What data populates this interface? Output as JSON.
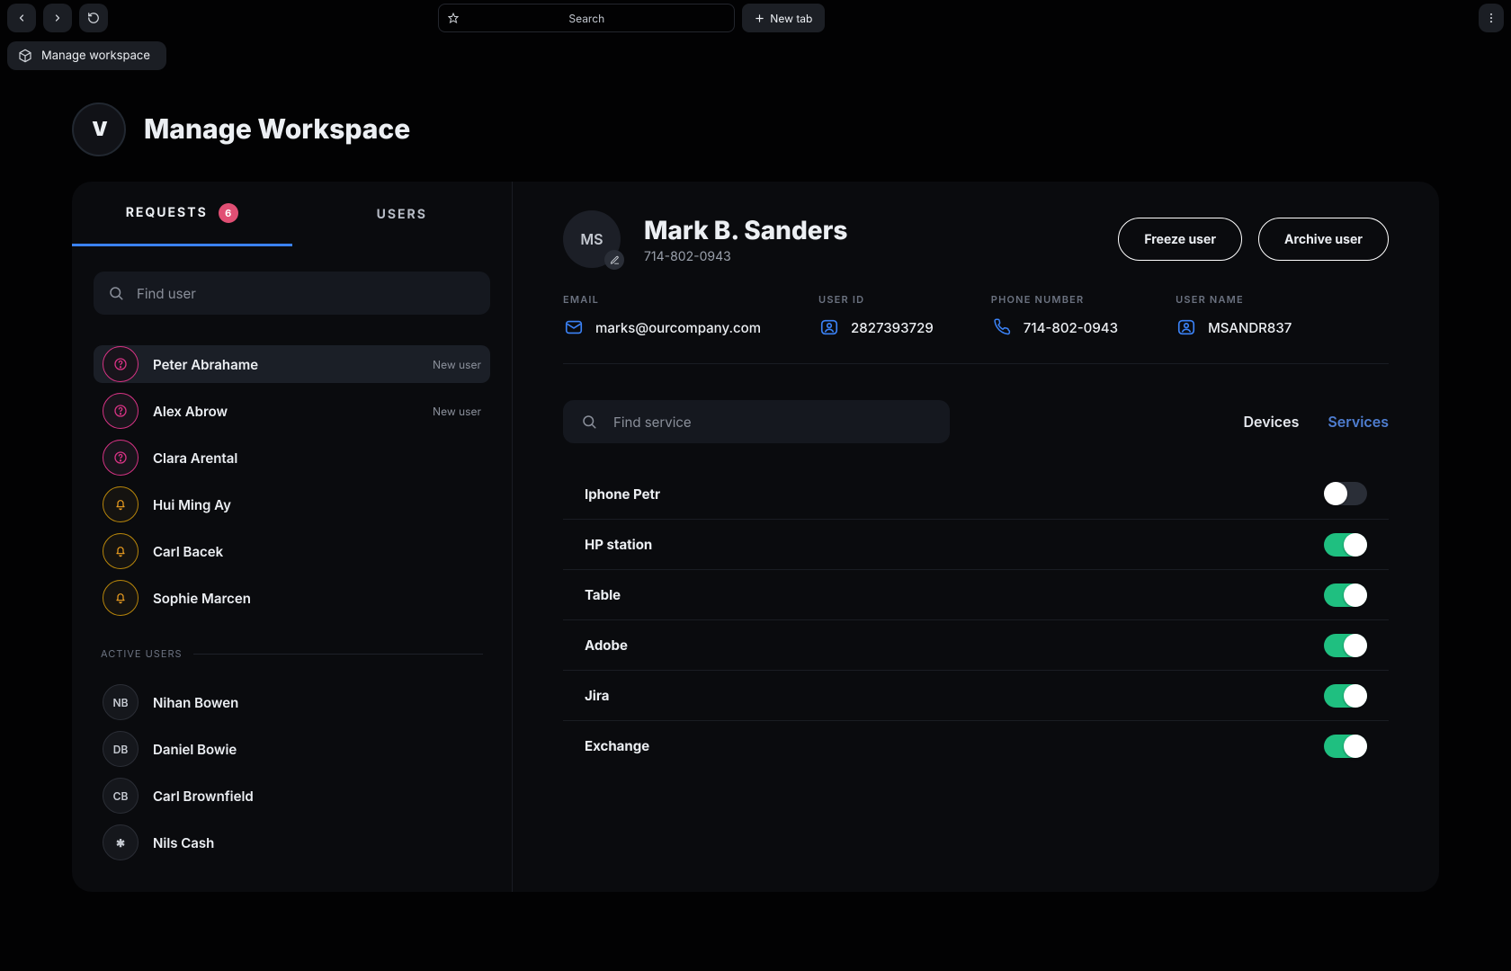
{
  "titlebar": {
    "search_placeholder": "Search",
    "new_tab_label": "New tab"
  },
  "tab": {
    "label": "Manage workspace"
  },
  "page": {
    "title": "Manage Workspace"
  },
  "sidebar": {
    "tabs": {
      "requests": "REQUESTS",
      "users": "USERS",
      "badge": "6"
    },
    "find_placeholder": "Find user",
    "requests": [
      {
        "name": "Peter Abrahame",
        "tag": "New user",
        "icon": "question"
      },
      {
        "name": "Alex Abrow",
        "tag": "New user",
        "icon": "question"
      },
      {
        "name": "Clara Arental",
        "tag": "",
        "icon": "question"
      },
      {
        "name": "Hui Ming Ay",
        "tag": "",
        "icon": "bell"
      },
      {
        "name": "Carl Bacek",
        "tag": "",
        "icon": "bell"
      },
      {
        "name": "Sophie Marcen",
        "tag": "",
        "icon": "bell"
      }
    ],
    "active_label": "ACTIVE USERS",
    "active": [
      {
        "initials": "NB",
        "name": "Nihan Bowen"
      },
      {
        "initials": "DB",
        "name": "Daniel Bowie"
      },
      {
        "initials": "CB",
        "name": "Carl Brownfield"
      },
      {
        "initials": "✱",
        "name": "Nils Cash"
      }
    ]
  },
  "profile": {
    "initials": "MS",
    "name": "Mark B. Sanders",
    "phone": "714-802-0943",
    "actions": {
      "freeze": "Freeze user",
      "archive": "Archive user"
    },
    "info": {
      "email_label": "EMAIL",
      "email": "marks@ourcompany.com",
      "userid_label": "USER ID",
      "userid": "2827393729",
      "phone_label": "PHONE NUMBER",
      "phone_val": "714-802-0943",
      "username_label": "USER NAME",
      "username": "MSANDR837"
    }
  },
  "services": {
    "find_placeholder": "Find service",
    "tabs": {
      "devices": "Devices",
      "services": "Services"
    },
    "items": [
      {
        "name": "Iphone Petr",
        "on": false
      },
      {
        "name": "HP station",
        "on": true
      },
      {
        "name": "Table",
        "on": true
      },
      {
        "name": "Adobe",
        "on": true
      },
      {
        "name": "Jira",
        "on": true
      },
      {
        "name": "Exchange",
        "on": true
      }
    ]
  }
}
